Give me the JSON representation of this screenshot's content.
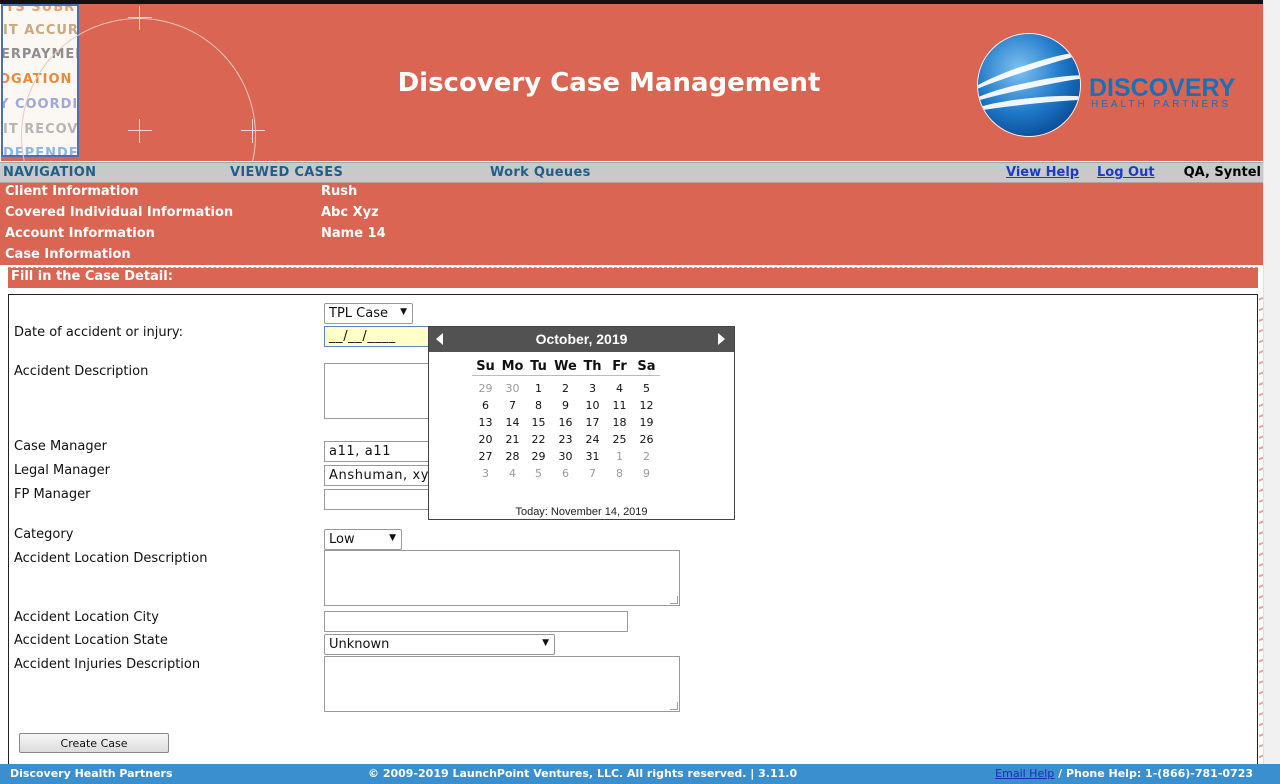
{
  "header": {
    "title": "Discovery Case Management",
    "brand_name": "DISCOVERY",
    "brand_sub": "HEALTH PARTNERS",
    "logo_words": [
      "PTS SUBR",
      "IT ACCURA",
      "ERPAYMEN",
      "OGATION D",
      "Y COORDIN",
      "IT RECOVE",
      "DEPENDEN"
    ]
  },
  "nav": {
    "navigation": "NAVIGATION",
    "viewed_cases": "VIEWED CASES",
    "work_queues": "Work Queues",
    "view_help": "View Help",
    "log_out": "Log Out",
    "user": "QA, Syntel"
  },
  "info": {
    "client_label": "Client Information",
    "client_value": "Rush",
    "covered_label": "Covered Individual Information",
    "covered_value": "Abc Xyz",
    "account_label": "Account Information",
    "account_value": "Name 14",
    "case_label": "Case Information"
  },
  "form": {
    "section_title": "Fill in the Case Detail:",
    "case_type": "TPL Case",
    "date_label": "Date of accident or injury:",
    "date_value": "__/__/____",
    "accident_desc_label": "Accident Description",
    "case_manager_label": "Case Manager",
    "case_manager_value": "a11, a11",
    "legal_manager_label": "Legal Manager",
    "legal_manager_value": "Anshuman, xyz",
    "fp_manager_label": "FP Manager",
    "fp_manager_value": "",
    "category_label": "Category",
    "category_value": "Low",
    "loc_desc_label": "Accident Location Description",
    "loc_city_label": "Accident Location City",
    "loc_city_value": "",
    "loc_state_label": "Accident Location State",
    "loc_state_value": "Unknown",
    "injuries_label": "Accident Injuries Description",
    "create_button": "Create Case"
  },
  "calendar": {
    "month_label": "October, 2019",
    "days_of_week": [
      "Su",
      "Mo",
      "Tu",
      "We",
      "Th",
      "Fr",
      "Sa"
    ],
    "weeks": [
      [
        "29",
        "30",
        "1",
        "2",
        "3",
        "4",
        "5"
      ],
      [
        "6",
        "7",
        "8",
        "9",
        "10",
        "11",
        "12"
      ],
      [
        "13",
        "14",
        "15",
        "16",
        "17",
        "18",
        "19"
      ],
      [
        "20",
        "21",
        "22",
        "23",
        "24",
        "25",
        "26"
      ],
      [
        "27",
        "28",
        "29",
        "30",
        "31",
        "1",
        "2"
      ],
      [
        "3",
        "4",
        "5",
        "6",
        "7",
        "8",
        "9"
      ]
    ],
    "today_label": "Today: November 14, 2019"
  },
  "footer": {
    "left": "Discovery Health Partners",
    "center": "© 2009-2019 LaunchPoint Ventures, LLC. All rights reserved. | 3.11.0",
    "email_help": "Email Help",
    "phone_help": " / Phone Help: 1-(866)-781-0723"
  },
  "colors": {
    "brand_red": "#d96552",
    "brand_blue": "#1b6fb8",
    "footer_blue": "#3a8fcf",
    "nav_gray": "#c9c9c9"
  }
}
